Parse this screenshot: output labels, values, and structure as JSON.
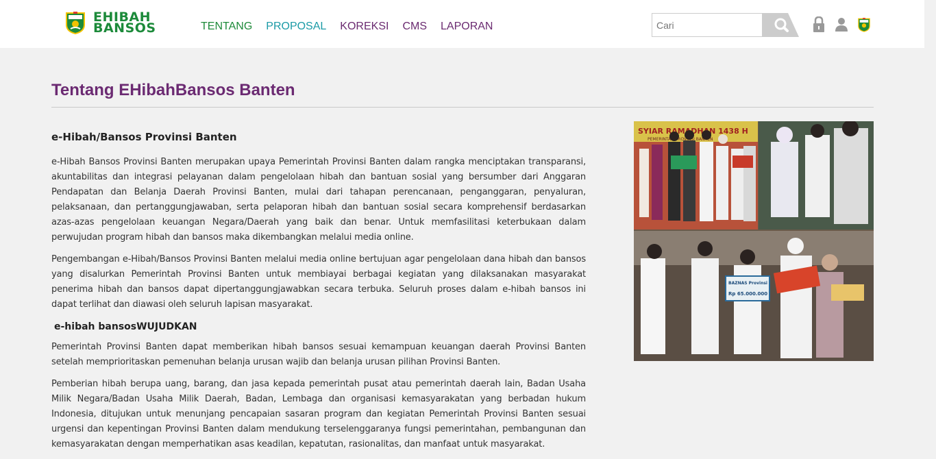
{
  "brand": {
    "line1": "EHIBAH",
    "line2": "BANSOS",
    "green": "#1c8a3a",
    "purple": "#6b2a72"
  },
  "nav": {
    "items": [
      {
        "label": "TENTANG",
        "color": "#1e8a3a"
      },
      {
        "label": "PROPOSAL",
        "color": "#1a9aa6"
      },
      {
        "label": "KOREKSI",
        "color": "#6a2a70"
      },
      {
        "label": "CMS",
        "color": "#6a2a70"
      },
      {
        "label": "LAPORAN",
        "color": "#6a2a70"
      }
    ]
  },
  "search": {
    "placeholder": "Cari",
    "icon": "search-icon"
  },
  "header_icons": [
    "lock-icon",
    "user-icon",
    "province-emblem-icon"
  ],
  "page": {
    "title": "Tentang EHibahBansos Banten"
  },
  "article": {
    "heading": "e-Hibah/Bansos Provinsi Banten",
    "paragraphs": [
      "e-Hibah Bansos Provinsi Banten merupakan upaya Pemerintah Provinsi Banten dalam rangka menciptakan transparansi, akuntabilitas dan integrasi pelayanan dalam pengelolaan hibah dan bantuan sosial yang bersumber dari Anggaran Pendapatan dan Belanja Daerah Provinsi Banten, mulai dari tahapan perencanaan, penganggaran, penyaluran, pelaksanaan, dan pertanggungjawaban, serta pelaporan hibah dan bantuan sosial secara komprehensif berdasarkan azas-azas pengelolaan keuangan Negara/Daerah yang baik dan benar. Untuk memfasilitasi keterbukaan dalam perwujudan program hibah dan bansos maka dikembangkan melalui media online.",
      "Pengembangan e-Hibah/Bansos Provinsi Banten melalui media online bertujuan agar pengelolaan dana hibah dan bansos yang disalurkan Pemerintah Provinsi Banten untuk membiayai berbagai kegiatan yang dilaksanakan masyarakat penerima hibah dan bansos dapat dipertanggungjawabkan secara terbuka. Seluruh proses dalam e-hibah bansos ini dapat terlihat dan diawasi oleh seluruh lapisan masyarakat."
    ],
    "subheading": "e-hibah bansosWUJUDKAN",
    "paragraphs2": [
      "Pemerintah Provinsi Banten dapat memberikan hibah bansos sesuai kemampuan keuangan daerah Provinsi Banten setelah memprioritaskan pemenuhan belanja urusan wajib dan belanja urusan pilihan Provinsi Banten.",
      "Pemberian hibah berupa uang, barang, dan jasa kepada pemerintah pusat atau pemerintah daerah lain, Badan Usaha Milik Negara/Badan Usaha Milik Daerah, Badan, Lembaga dan organisasi kemasyarakatan yang berbadan hukum Indonesia, ditujukan untuk menunjang pencapaian sasaran program dan kegiatan Pemerintah Provinsi Banten sesuai urgensi dan kepentingan Provinsi Banten dalam mendukung terselenggaranya fungsi pemerintahan, pembangunan dan kemasyarakatan dengan memperhatikan asas keadilan, kepatutan, rasionalitas, dan manfaat untuk masyarakat."
    ]
  },
  "photo": {
    "banner_text": "SYIAR RAMADHAN 1438 H",
    "banner_sub": "PEMERINTAH PROVINSI BANTEN",
    "board_text": "BAZNAS Provinsi",
    "board_amount": "Rp 65.000.000"
  }
}
